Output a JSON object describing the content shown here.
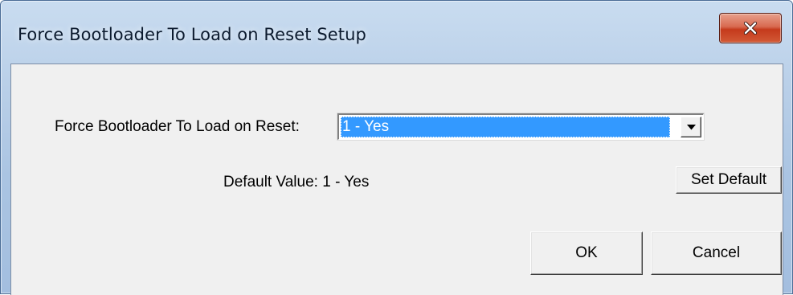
{
  "window": {
    "title": "Force Bootloader To Load on Reset Setup",
    "close_icon": "close-x-icon",
    "close_color": "#c53a1c"
  },
  "form": {
    "field_label": "Force Bootloader To Load on Reset:",
    "selected_value": "1 - Yes",
    "dropdown_icon": "chevron-down-icon",
    "default_label": "Default Value:",
    "default_value": "1 - Yes",
    "selection_color": "#3399ff"
  },
  "buttons": {
    "set_default": "Set Default",
    "ok": "OK",
    "cancel": "Cancel"
  }
}
